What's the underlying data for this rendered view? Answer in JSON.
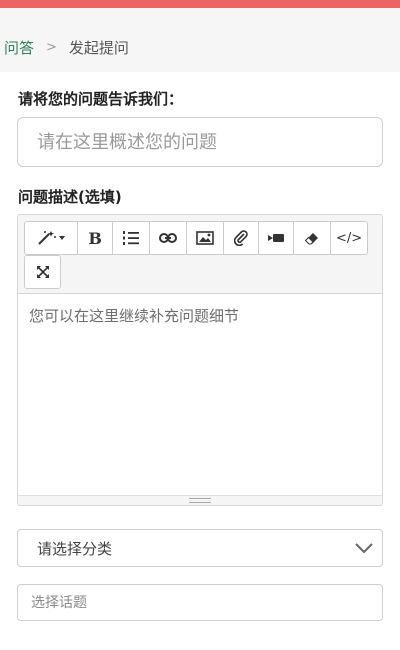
{
  "breadcrumb": {
    "home": "问答",
    "separator": ">",
    "current": "发起提问"
  },
  "form": {
    "title_label": "请将您的问题告诉我们：",
    "title_placeholder": "请在这里概述您的问题",
    "desc_label": "问题描述(选填)",
    "desc_placeholder": "您可以在这里继续补充问题细节",
    "category_value": "请选择分类",
    "topic_placeholder": "选择话题"
  },
  "toolbar": {
    "buttons": [
      "magic-wand-icon",
      "bold-icon",
      "ordered-list-icon",
      "link-icon",
      "image-icon",
      "attachment-icon",
      "video-icon",
      "eraser-icon",
      "code-icon",
      "fullscreen-icon"
    ],
    "bold_glyph": "B",
    "code_glyph": "</>"
  },
  "colors": {
    "top_bar": "#ec6563",
    "breadcrumb_link": "#2f7f5f"
  }
}
